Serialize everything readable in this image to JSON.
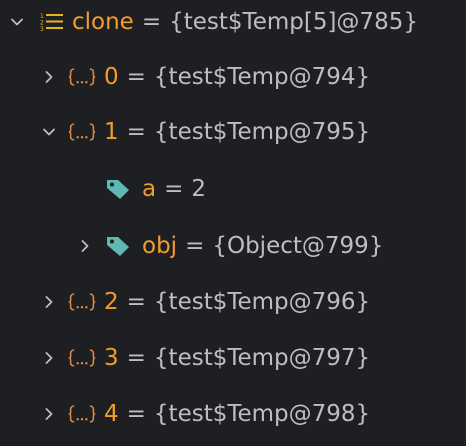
{
  "theme": {
    "background": "#1e1f22",
    "name_color": "#f39c2b",
    "value_color": "#bcbec4",
    "object_icon_color": "#d9844a",
    "field_icon_color": "#5fb8b1",
    "list_icon_color": "#e6b422"
  },
  "variables": {
    "root": {
      "name": "clone",
      "value": "{test$Temp[5]@785}",
      "expanded": true,
      "icon": "list-icon"
    },
    "items": [
      {
        "name": "0",
        "value": "{test$Temp@794}",
        "expanded": false,
        "icon": "object-icon"
      },
      {
        "name": "1",
        "value": "{test$Temp@795}",
        "expanded": true,
        "icon": "object-icon",
        "children": [
          {
            "name": "a",
            "value": "2",
            "expandable": false,
            "icon": "field-tag-icon"
          },
          {
            "name": "obj",
            "value": "{Object@799}",
            "expandable": true,
            "expanded": false,
            "icon": "field-tag-icon"
          }
        ]
      },
      {
        "name": "2",
        "value": "{test$Temp@796}",
        "expanded": false,
        "icon": "object-icon"
      },
      {
        "name": "3",
        "value": "{test$Temp@797}",
        "expanded": false,
        "icon": "object-icon"
      },
      {
        "name": "4",
        "value": "{test$Temp@798}",
        "expanded": false,
        "icon": "object-icon"
      }
    ],
    "equals": "="
  }
}
